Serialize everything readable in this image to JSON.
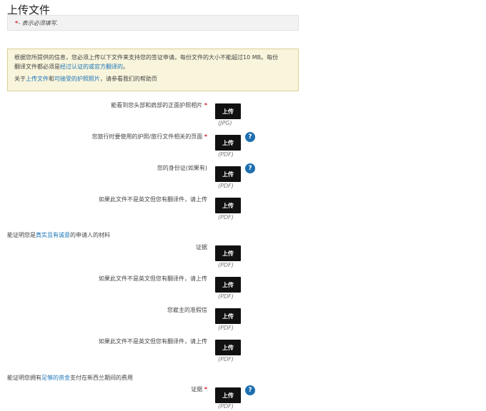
{
  "page": {
    "title": "上传文件"
  },
  "required_note": {
    "star": "*",
    "text": " - 表示必须填写."
  },
  "info": {
    "line1": "根据您所提供的信息，您必须上传以下文件来支持您的签证申请。每份文件的大小不能超过10 MB。每份",
    "line2_prefix": "翻译文件都必须是",
    "line2_link": "经过认证的或官方翻译的",
    "line2_suffix": "。",
    "about_prefix": "关于",
    "about_link1": "上传文件",
    "about_mid": "和",
    "about_link2": "可接受的护照照片",
    "about_suffix": "，请参看我们的帮助页"
  },
  "upload_label": "上传",
  "required_star": "*",
  "help_glyph": "?",
  "fields": [
    {
      "label": "能看到您头部和肩部的正面护照相片",
      "required": true,
      "type": "(JPG)",
      "help": false
    },
    {
      "label": "您旅行时要使用的护照/旅行文件相关的页面",
      "required": true,
      "type": "(PDF)",
      "help": true
    },
    {
      "label": "您的身份证(如果有)",
      "required": false,
      "type": "(PDF)",
      "help": true
    },
    {
      "label": "如果此文件不是英文但您有翻译件，请上传",
      "required": false,
      "type": "(PDF)",
      "help": false
    },
    {
      "label": "证据",
      "required": false,
      "type": "(PDF)",
      "help": false
    },
    {
      "label": "如果此文件不是英文但您有翻译件，请上传",
      "required": false,
      "type": "(PDF)",
      "help": false
    },
    {
      "label": "您雇主的准假信",
      "required": false,
      "type": "(PDF)",
      "help": false
    },
    {
      "label": "如果此文件不是英文但您有翻译件，请上传",
      "required": false,
      "type": "(PDF)",
      "help": false
    },
    {
      "label": "证据",
      "required": true,
      "type": "(PDF)",
      "help": true
    }
  ],
  "section1": {
    "prefix": "能证明您是",
    "link": "真实且有诚意",
    "suffix": "的申请人的材料"
  },
  "section2": {
    "prefix": "能证明您拥有",
    "link": "足够的资金",
    "suffix": "支付在新西兰期间的费用"
  }
}
